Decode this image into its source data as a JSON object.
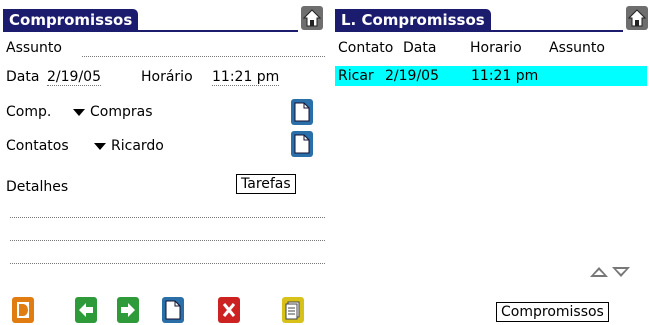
{
  "left": {
    "title": "Compromissos",
    "assunto_label": "Assunto",
    "data_label": "Data",
    "data_value": "2/19/05",
    "horario_label": "Horário",
    "horario_value": "11:21 pm",
    "comp_label": "Comp.",
    "comp_value": "Compras",
    "contatos_label": "Contatos",
    "contatos_value": "Ricardo",
    "detalhes_label": "Detalhes",
    "tarefas_button": "Tarefas",
    "toolbar_icons": [
      "details-icon",
      "back-icon",
      "forward-icon",
      "new-doc-icon",
      "delete-icon",
      "notes-icon"
    ]
  },
  "right": {
    "title": "L. Compromissos",
    "columns": [
      "Contato",
      "Data",
      "Horario",
      "Assunto"
    ],
    "rows": [
      {
        "contato": "Ricar",
        "data": "2/19/05",
        "horario": "11:21 pm",
        "assunto": ""
      }
    ],
    "compromissos_button": "Compromissos"
  },
  "colors": {
    "title_bg": "#1c1c6e",
    "selection": "#00ffff",
    "toolbar_orange": "#e07c12",
    "toolbar_green": "#2f9a3a",
    "toolbar_blue": "#2a6fa8",
    "toolbar_red": "#cc2222",
    "toolbar_yellow": "#d8c21a"
  }
}
